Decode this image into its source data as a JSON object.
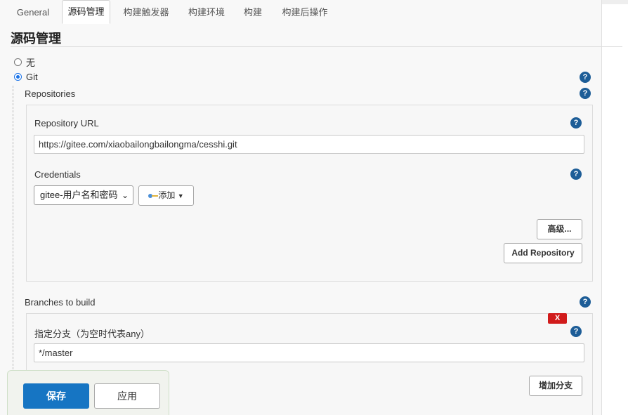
{
  "tabs": [
    "General",
    "源码管理",
    "构建触发器",
    "构建环境",
    "构建",
    "构建后操作"
  ],
  "active_tab": "源码管理",
  "section": {
    "title": "源码管理"
  },
  "scm_options": {
    "none_label": "无",
    "git_label": "Git",
    "selected": "Git"
  },
  "repositories": {
    "label": "Repositories",
    "url_label": "Repository URL",
    "url_value": "https://gitee.com/xiaobailongbailongma/cesshi.git",
    "credentials_label": "Credentials",
    "credentials_selected": "gitee-用户名和密码",
    "add_button": "添加",
    "advanced_button": "高级...",
    "add_repository_button": "Add Repository"
  },
  "branches": {
    "label": "Branches to build",
    "delete_button": "X",
    "branch_label": "指定分支（为空时代表any）",
    "branch_value": "*/master",
    "add_branch_button": "增加分支"
  },
  "footer": {
    "save": "保存",
    "apply": "应用"
  },
  "help_symbol": "?",
  "icons": [
    "help-icon",
    "key-icon",
    "caret-down-icon",
    "chevron-down-icon"
  ],
  "colors": {
    "primary": "#1675c3",
    "help": "#1d5d97",
    "danger": "#d11b1b"
  }
}
